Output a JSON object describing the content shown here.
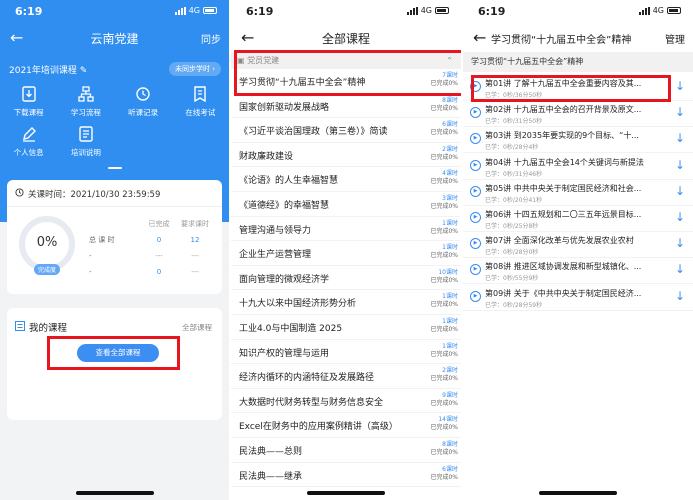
{
  "status": {
    "time": "6:19",
    "network": "4G"
  },
  "panel1": {
    "nav_title": "云南党建",
    "nav_right": "同步",
    "year_label": "2021年培训课程",
    "sync_label": "未同步学时",
    "menu": [
      {
        "label": "下载课程",
        "icon": "download-doc-icon"
      },
      {
        "label": "学习流程",
        "icon": "flow-icon"
      },
      {
        "label": "听课记录",
        "icon": "history-icon"
      },
      {
        "label": "在线考试",
        "icon": "exam-icon"
      },
      {
        "label": "个人信息",
        "icon": "edit-icon"
      },
      {
        "label": "培训说明",
        "icon": "doc-icon"
      }
    ],
    "close_time": "关课时间：2021/10/30 23:59:59",
    "progress": {
      "percent_label": "0%",
      "caption": "完成度"
    },
    "stats": {
      "col_done": "已完成",
      "col_required": "要求课时",
      "rows": [
        {
          "label": "总 课 时",
          "done": "0",
          "required": "12"
        },
        {
          "label": "-",
          "done": "---",
          "required": "---"
        },
        {
          "label": "-",
          "done": "0",
          "required": "---"
        }
      ]
    },
    "my_courses": "我的课程",
    "all_courses": "全部课程",
    "view_all_button": "查看全部课程"
  },
  "panel2": {
    "nav_title": "全部课程",
    "section": "党员党建",
    "courses": [
      {
        "title": "学习贯彻“十九届五中全会”精神",
        "hours": "7课时",
        "done": "已完成0%"
      },
      {
        "title": "国家创新驱动发展战略",
        "hours": "8课时",
        "done": "已完成0%"
      },
      {
        "title": "《习近平谈治国理政（第三卷）》简读",
        "hours": "6课时",
        "done": "已完成0%"
      },
      {
        "title": "财政廉政建设",
        "hours": "2课时",
        "done": "已完成0%"
      },
      {
        "title": "《论语》的人生幸福智慧",
        "hours": "4课时",
        "done": "已完成0%"
      },
      {
        "title": "《道德经》的幸福智慧",
        "hours": "3课时",
        "done": "已完成0%"
      },
      {
        "title": "管理沟通与领导力",
        "hours": "1课时",
        "done": "已完成0%"
      },
      {
        "title": "企业生产运营管理",
        "hours": "1课时",
        "done": "已完成0%"
      },
      {
        "title": "面向管理的微观经济学",
        "hours": "10课时",
        "done": "已完成0%"
      },
      {
        "title": "十九大以来中国经济形势分析",
        "hours": "1课时",
        "done": "已完成0%"
      },
      {
        "title": "工业4.0与中国制造 2025",
        "hours": "1课时",
        "done": "已完成0%"
      },
      {
        "title": "知识产权的管理与运用",
        "hours": "1课时",
        "done": "已完成0%"
      },
      {
        "title": "经济内循环的内涵特征及发展路径",
        "hours": "2课时",
        "done": "已完成0%"
      },
      {
        "title": "大数据时代财务转型与财务信息安全",
        "hours": "9课时",
        "done": "已完成0%"
      },
      {
        "title": "Excel在财务中的应用案例精讲（高级）",
        "hours": "14课时",
        "done": "已完成0%"
      },
      {
        "title": "民法典——总则",
        "hours": "8课时",
        "done": "已完成0%"
      },
      {
        "title": "民法典——继承",
        "hours": "6课时",
        "done": "已完成0%"
      }
    ]
  },
  "panel3": {
    "nav_title": "学习贯彻“十九届五中全会”精神",
    "nav_right": "管理",
    "header": "学习贯彻“十九届五中全会”精神",
    "lessons": [
      {
        "title": "第01讲  了解十九届五中全会重要内容及其...",
        "sub": "已学：0秒/36分50秒"
      },
      {
        "title": "第02讲  十九届五中全会的召开背景及原文...",
        "sub": "已学：0秒/31分50秒"
      },
      {
        "title": "第03讲  到2035年要实现的9个目标、“十...",
        "sub": "已学：0秒/28分4秒"
      },
      {
        "title": "第04讲  十九届五中全会14个关键词与新提法",
        "sub": "已学：0秒/31分46秒"
      },
      {
        "title": "第05讲  中共中央关于制定国民经济和社会...",
        "sub": "已学：0秒/20分41秒"
      },
      {
        "title": "第06讲  十四五规划和二〇三五年远景目标...",
        "sub": "已学：0秒/25分8秒"
      },
      {
        "title": "第07讲  全面深化改革与优先发展农业农村",
        "sub": "已学：0秒/28分0秒"
      },
      {
        "title": "第08讲  推进区域协调发展和新型城镇化、...",
        "sub": "已学：0秒/55分9秒"
      },
      {
        "title": "第09讲  关于《中共中央关于制定国民经济...",
        "sub": "已学：0秒/28分59秒"
      }
    ]
  },
  "colors": {
    "primary": "#2f8ef0",
    "highlight": "#e8141e"
  }
}
